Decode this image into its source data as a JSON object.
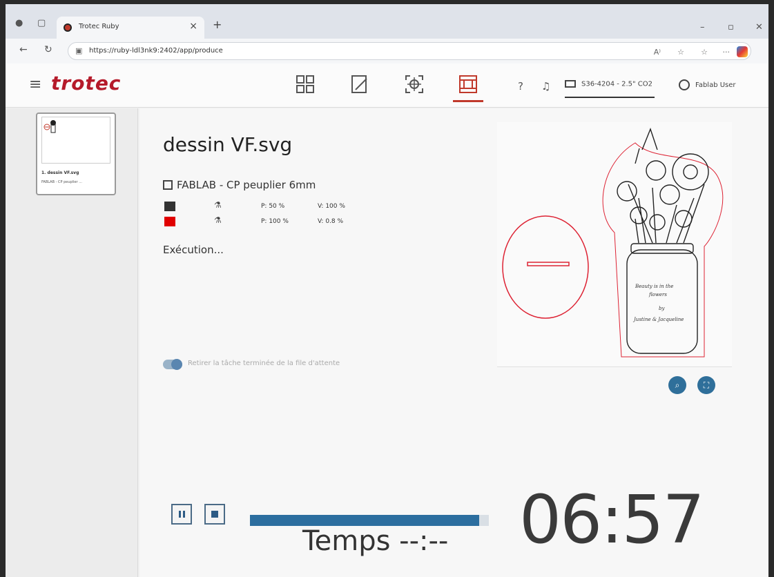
{
  "browser": {
    "tab_title": "Trotec Ruby",
    "new_tab": "+",
    "tab_close": "×",
    "url": "https://ruby-ldl3nk9:2402/app/produce",
    "read_aloud": "A⁾",
    "menu_dots": "···"
  },
  "app": {
    "logo": "trotec",
    "machine": "S36-4204 - 2.5\" CO2",
    "user": "Fablab User"
  },
  "queue": {
    "job_name": "1. dessin VF.svg",
    "job_material": "FABLAB - CP peuplier ..."
  },
  "job": {
    "title": "dessin VF.svg",
    "material": "FABLAB - CP peuplier 6mm",
    "params": [
      {
        "color": "#333333",
        "power": "P: 50 %",
        "speed": "V: 100 %"
      },
      {
        "color": "#e00000",
        "power": "P: 100 %",
        "speed": "V: 0.8 %"
      }
    ],
    "status": "Exécution...",
    "remove_label": "Retirer la tâche terminée de la file d'attente",
    "remove_enabled": true
  },
  "controls": {
    "progress_fraction": 0.96,
    "time_label": "Temps --:--",
    "countdown": "06:57"
  },
  "colors": {
    "brand": "#b51a2a",
    "accent_blue": "#2c6e9f"
  }
}
